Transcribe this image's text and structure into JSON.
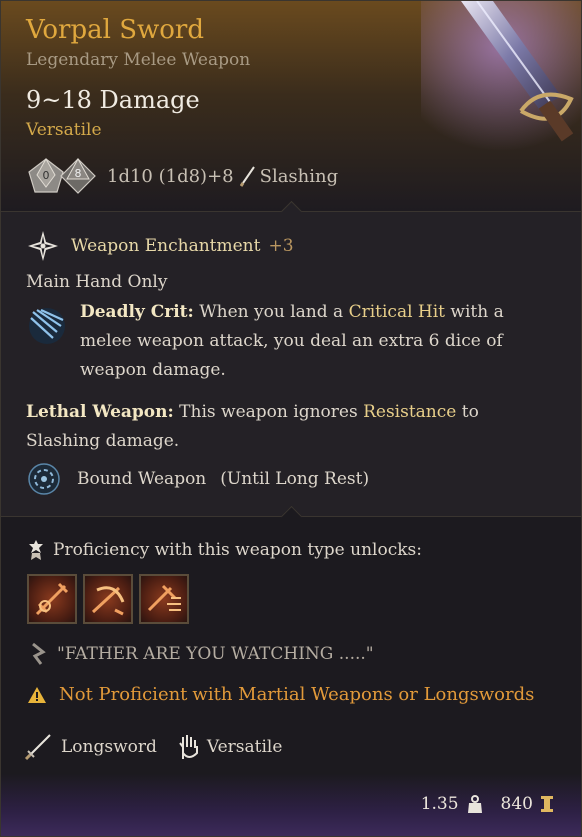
{
  "item": {
    "name": "Vorpal Sword",
    "category": "Legendary Melee Weapon",
    "damage": "9~18 Damage",
    "property_tag": "Versatile",
    "dice": {
      "die1": "0",
      "die2": "8"
    },
    "dice_formula": "1d10 (1d8)+8",
    "damage_type": "Slashing",
    "icon": "sword-artwork"
  },
  "enchant": {
    "label": "Weapon Enchantment",
    "bonus": "+3",
    "icon": "enchantment-icon"
  },
  "main_hand": "Main Hand Only",
  "deadly_crit": {
    "title": "Deadly Crit:",
    "text1": " When you land a ",
    "critical_hit": "Critical Hit",
    "text2": " with a melee weapon attack, you deal an extra 6 dice of weapon damage."
  },
  "lethal": {
    "title": "Lethal Weapon:",
    "text1": " This weapon ignores ",
    "resistance": "Resistance",
    "text2": " to Slashing damage."
  },
  "bound": {
    "label": "Bound Weapon",
    "duration": "(Until Long Rest)"
  },
  "proficiency": {
    "label": "Proficiency with this weapon type unlocks:",
    "slots": [
      "action-slot-1",
      "action-slot-2",
      "action-slot-3"
    ]
  },
  "quote": "\"FATHER ARE YOU WATCHING .....\"",
  "warning": {
    "not_proficient": "Not Proficient",
    "with_text": "with Martial Weapons or Longswords"
  },
  "types": {
    "weapon_type": "Longsword",
    "property": "Versatile"
  },
  "footer": {
    "weight": "1.35",
    "value": "840"
  },
  "colors": {
    "title": "#e0a83e",
    "warning": "#e29a3a",
    "highlight": "#e8cf8a"
  }
}
